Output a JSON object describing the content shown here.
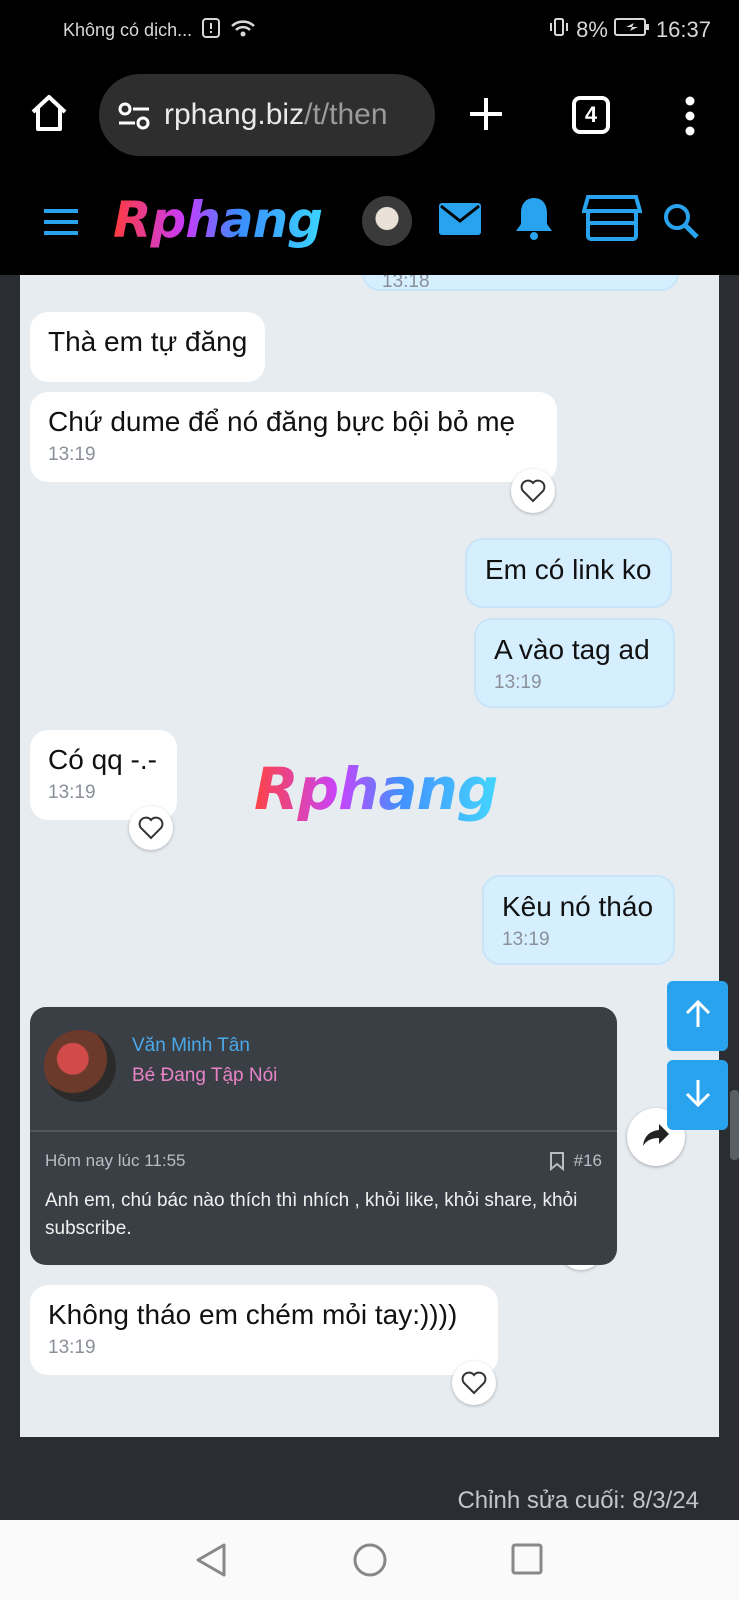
{
  "status_bar": {
    "carrier_text": "Không có dịch...",
    "battery": "8%",
    "time": "16:37"
  },
  "browser": {
    "url_host": "rphang.biz",
    "url_path": "/t/then",
    "tab_count": "4"
  },
  "site": {
    "logo_text": "Rphang",
    "watermark_text": "Rphang"
  },
  "messages": [
    {
      "text": "13:18",
      "side": "out"
    },
    {
      "text": "Thà em tự đăng",
      "side": "in"
    },
    {
      "text": "Chứ dume để nó đăng bực bội bỏ mẹ",
      "time": "13:19",
      "side": "in"
    },
    {
      "text": "Em có link ko",
      "side": "out"
    },
    {
      "text": "A vào tag ad",
      "time": "13:19",
      "side": "out"
    },
    {
      "text": "Có qq -.-",
      "time": "13:19",
      "side": "in"
    },
    {
      "text": "Kêu nó tháo",
      "time": "13:19",
      "side": "out"
    },
    {
      "text": "Không tháo em chém mỏi tay:))))",
      "time": "13:19",
      "side": "in"
    }
  ],
  "forwarded_post": {
    "author": "Văn Minh Tân",
    "user_title": "Bé Đang Tập Nói",
    "timestamp": "Hôm nay lúc 11:55",
    "post_number": "#16",
    "body": "Anh em, chú bác nào thích thì nhích , khỏi like, khỏi share, khỏi subscribe."
  },
  "footer": {
    "last_edited": "Chỉnh sửa cuối: 8/3/24"
  },
  "colors": {
    "accent": "#2aa3ee",
    "bubble_out": "#d6efff",
    "page_bg": "#2a2e33"
  }
}
